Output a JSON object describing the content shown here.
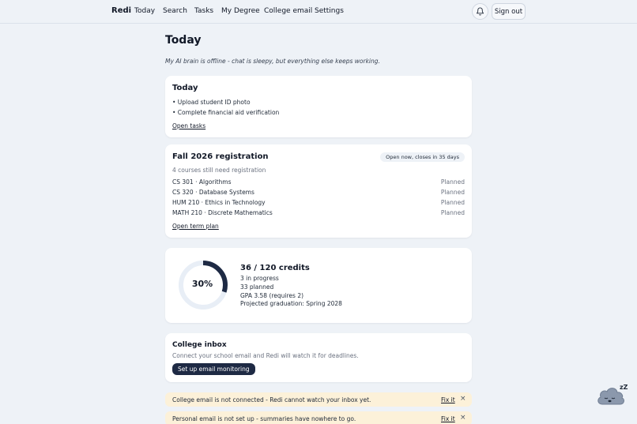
{
  "nav": {
    "brand": "Redi",
    "links": [
      "Today",
      "Search",
      "Tasks",
      "My Degree",
      "College email",
      "Settings"
    ],
    "sign_out": "Sign out"
  },
  "page": {
    "title": "Today",
    "offline_note": "My AI brain is offline - chat is sleepy, but everything else keeps working."
  },
  "today_card": {
    "title": "Today",
    "tasks": [
      "• Upload student ID photo",
      "• Complete financial aid verification"
    ],
    "open_link": "Open tasks"
  },
  "registration": {
    "title": "Fall 2026 registration",
    "badge": "Open now, closes in 35 days",
    "subtitle": "4 courses still need registration",
    "courses": [
      {
        "name": "CS 301 · Algorithms",
        "status": "Planned"
      },
      {
        "name": "CS 320 · Database Systems",
        "status": "Planned"
      },
      {
        "name": "HUM 210 · Ethics in Technology",
        "status": "Planned"
      },
      {
        "name": "MATH 210 · Discrete Mathematics",
        "status": "Planned"
      }
    ],
    "open_link": "Open term plan"
  },
  "degree": {
    "percent_label": "30%",
    "progress_fraction": 0.3,
    "credits": "36 / 120 credits",
    "in_progress": "3 in progress",
    "planned": "33 planned",
    "gpa": "GPA 3.58 (requires 2)",
    "graduation": "Projected graduation: Spring 2028",
    "ring_color": "#1e2a44",
    "ring_track_color": "#e8eef6"
  },
  "inbox": {
    "title": "College inbox",
    "subtitle": "Connect your school email and Redi will watch it for deadlines.",
    "button": "Set up email monitoring"
  },
  "banners": [
    {
      "message": "College email is not connected - Redi cannot watch your inbox yet.",
      "action": "Fix it",
      "close": "×"
    },
    {
      "message": "Personal email is not set up - summaries have nowhere to go.",
      "action": "Fix it",
      "close": "×"
    }
  ],
  "mascot": {
    "sleep_text": "zZ"
  }
}
